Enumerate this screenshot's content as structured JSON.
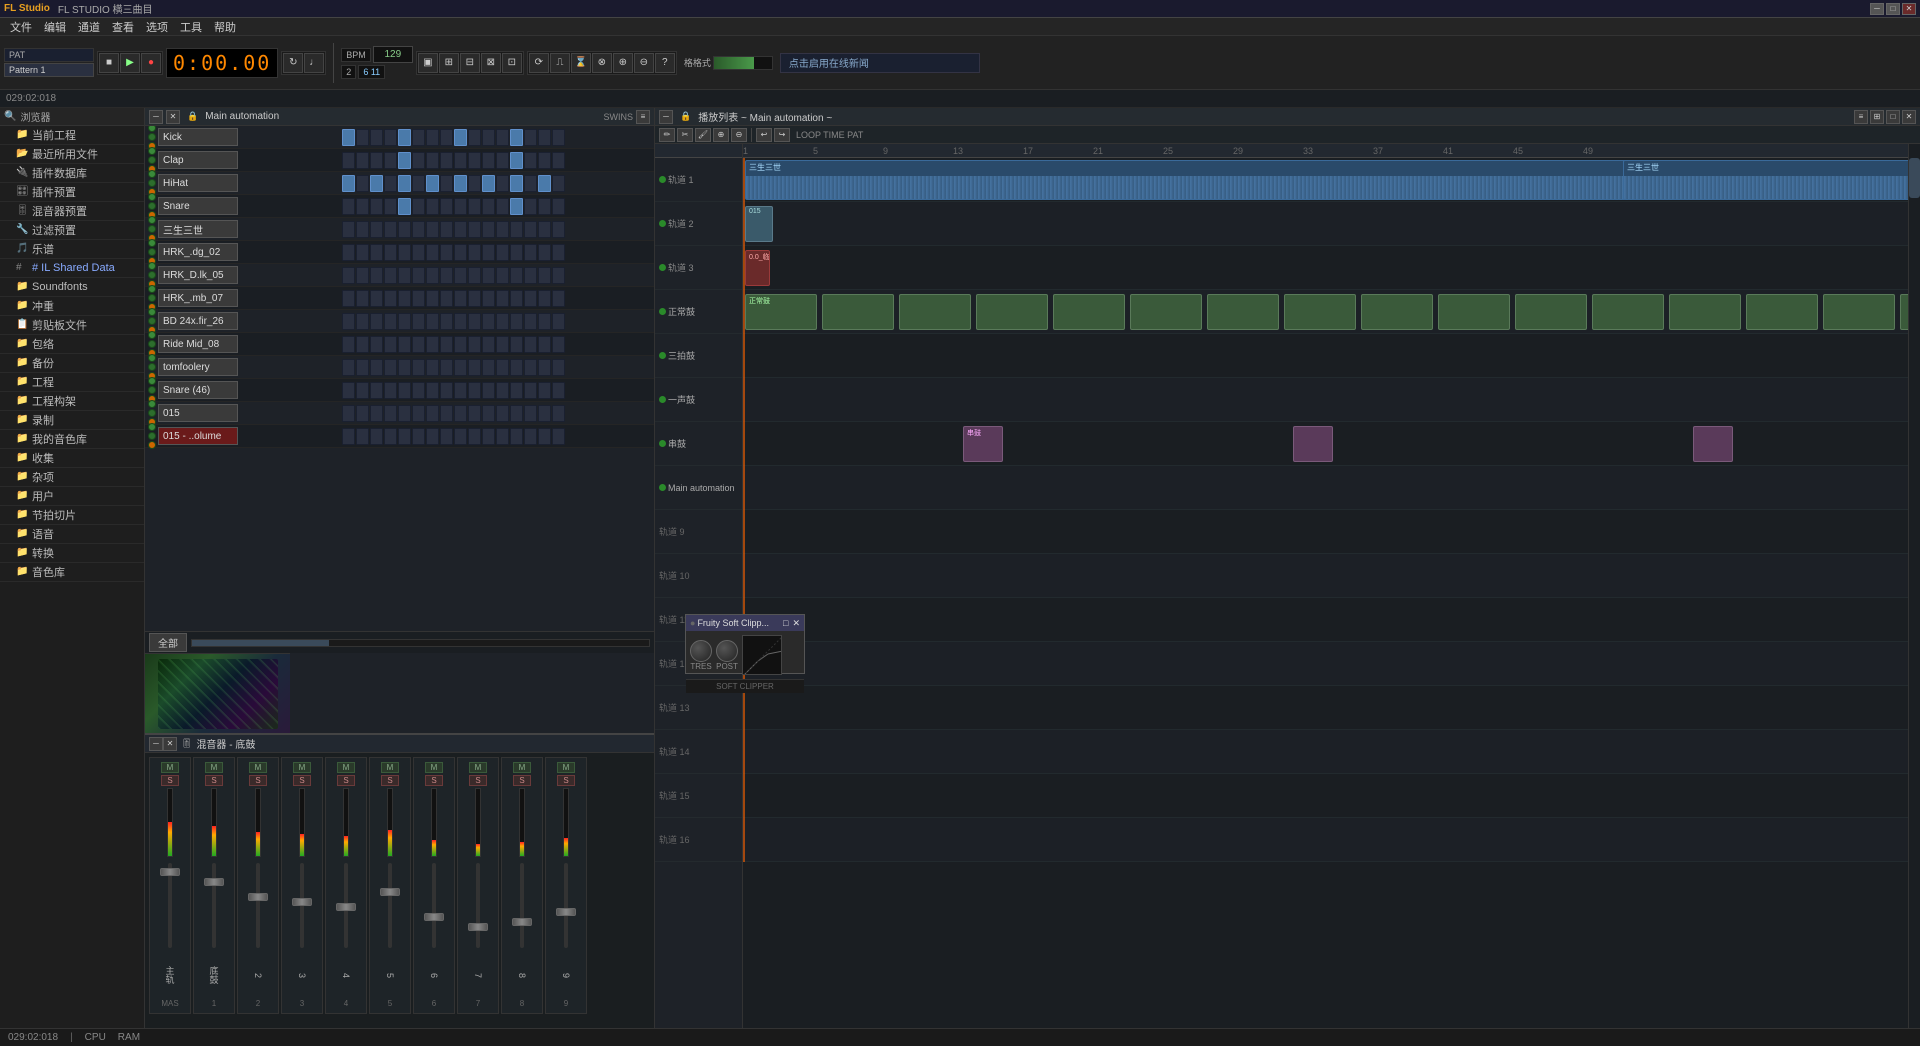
{
  "app": {
    "title": "FL STUDIO 横三曲目",
    "version": "FL Studio"
  },
  "titlebar": {
    "logo": "FL STUDIO",
    "title": "横三曲目",
    "min": "─",
    "max": "□",
    "close": "✕"
  },
  "menubar": {
    "items": [
      "文件",
      "编辑",
      "通道",
      "查看",
      "选项",
      "工具",
      "帮助"
    ]
  },
  "transport": {
    "time": "0:00.00",
    "bpm_label": "BPM",
    "bpm_value": "129",
    "beats_label": "2",
    "info": "029:02:018",
    "play": "▶",
    "stop": "■",
    "record": "●",
    "loop": "↻",
    "pattern": "PAT"
  },
  "toolbar_right": {
    "news_text": "点击启用在线新闻"
  },
  "sidebar": {
    "header": "浏览器",
    "items": [
      {
        "label": "当前工程",
        "icon": "folder"
      },
      {
        "label": "最近所用文件",
        "icon": "folder"
      },
      {
        "label": "插件数据库",
        "icon": "plugin"
      },
      {
        "label": "插件预置",
        "icon": "plugin"
      },
      {
        "label": "混音器预置",
        "icon": "mixer"
      },
      {
        "label": "过滤预置",
        "icon": "filter"
      },
      {
        "label": "乐谱",
        "icon": "music"
      },
      {
        "label": "# IL Shared Data",
        "icon": "folder",
        "highlighted": true
      },
      {
        "label": "Soundfonts",
        "icon": "folder"
      },
      {
        "label": "冲重",
        "icon": "folder"
      },
      {
        "label": "剪贴板文件",
        "icon": "folder"
      },
      {
        "label": "包络",
        "icon": "folder"
      },
      {
        "label": "备份",
        "icon": "folder"
      },
      {
        "label": "工程",
        "icon": "folder"
      },
      {
        "label": "工程构架",
        "icon": "folder"
      },
      {
        "label": "录制",
        "icon": "folder"
      },
      {
        "label": "我的音色库",
        "icon": "folder"
      },
      {
        "label": "收集",
        "icon": "folder"
      },
      {
        "label": "杂项",
        "icon": "folder"
      },
      {
        "label": "用户",
        "icon": "folder"
      },
      {
        "label": "节拍切片",
        "icon": "folder"
      },
      {
        "label": "语音",
        "icon": "folder"
      },
      {
        "label": "转换",
        "icon": "folder"
      },
      {
        "label": "音色库",
        "icon": "folder"
      }
    ]
  },
  "step_sequencer": {
    "title": "Main automation",
    "rows": [
      {
        "name": "Kick",
        "color": "normal",
        "active_steps": [
          0,
          4,
          8,
          12
        ]
      },
      {
        "name": "Clap",
        "color": "normal",
        "active_steps": [
          4,
          12
        ]
      },
      {
        "name": "HiHat",
        "color": "normal",
        "active_steps": [
          0,
          2,
          4,
          6,
          8,
          10,
          12,
          14
        ]
      },
      {
        "name": "Snare",
        "color": "normal",
        "active_steps": [
          4,
          12
        ]
      },
      {
        "name": "三生三世",
        "color": "normal",
        "active_steps": []
      },
      {
        "name": "HRK_.dg_02",
        "color": "normal",
        "active_steps": []
      },
      {
        "name": "HRK_D.lk_05",
        "color": "normal",
        "active_steps": []
      },
      {
        "name": "HRK_.mb_07",
        "color": "normal",
        "active_steps": []
      },
      {
        "name": "BD 24x.fir_26",
        "color": "normal",
        "active_steps": []
      },
      {
        "name": "Ride Mid_08",
        "color": "normal",
        "active_steps": []
      },
      {
        "name": "tomfoolery",
        "color": "normal",
        "active_steps": []
      },
      {
        "name": "Snare (46)",
        "color": "normal",
        "active_steps": []
      },
      {
        "name": "015",
        "color": "normal",
        "active_steps": []
      },
      {
        "name": "015 - ..olume",
        "color": "red",
        "active_steps": []
      }
    ],
    "all_btn": "全部"
  },
  "playlist": {
    "title": "播放列表 ~ Main automation ~",
    "tracks": [
      {
        "name": "轨道 1",
        "type": "audio"
      },
      {
        "name": "轨道 2",
        "type": "audio"
      },
      {
        "name": "轨道 3",
        "type": "audio"
      },
      {
        "name": "正常鼓",
        "type": "midi"
      },
      {
        "name": "三拍鼓",
        "type": "midi"
      },
      {
        "name": "一声鼓",
        "type": "midi"
      },
      {
        "name": "串鼓",
        "type": "midi"
      },
      {
        "name": "Main automation",
        "type": "automation"
      },
      {
        "name": "轨道 9",
        "type": "empty"
      },
      {
        "name": "轨道 10",
        "type": "empty"
      },
      {
        "name": "轨道 11",
        "type": "empty"
      },
      {
        "name": "轨道 12",
        "type": "empty"
      },
      {
        "name": "轨道 13",
        "type": "empty"
      },
      {
        "name": "轨道 14",
        "type": "empty"
      },
      {
        "name": "轨道 15",
        "type": "empty"
      },
      {
        "name": "轨道 16",
        "type": "empty"
      }
    ]
  },
  "clips": {
    "track1_clip1": {
      "label": "三生三世",
      "color": "#2a4a6a",
      "x_pct": 2,
      "width_pct": 90
    },
    "track1_clip2": {
      "label": "三生三世",
      "color": "#2a4a6a",
      "x_pct": 68,
      "width_pct": 32
    },
    "track3_clip1": {
      "label": "0.0_临",
      "color": "#6a2a2a",
      "x_pct": 2,
      "width_pct": 5
    },
    "drums_clip": {
      "label": "正常鼓",
      "color": "#3a5a3a"
    }
  },
  "mixer": {
    "title": "混音器 - 底鼓",
    "channels": [
      {
        "label": "主轨",
        "level": 85
      },
      {
        "label": "底鼓",
        "level": 75
      },
      {
        "label": "2",
        "level": 60
      },
      {
        "label": "3",
        "level": 55
      },
      {
        "label": "4",
        "level": 50
      },
      {
        "label": "5",
        "level": 65
      },
      {
        "label": "6",
        "level": 40
      },
      {
        "label": "7",
        "level": 30
      },
      {
        "label": "8",
        "level": 35
      },
      {
        "label": "9",
        "level": 45
      }
    ]
  },
  "plugin_popup": {
    "title": "Fruity Soft Clipp...",
    "knob1_label": "TRES",
    "knob2_label": "POST",
    "btn_label": "SOFT CLIPPER"
  },
  "statusbar": {
    "info": "029:02:018",
    "cpu": "CPU",
    "ram": "RAM"
  },
  "timeline_markers": [
    "1",
    "5",
    "9",
    "13",
    "17",
    "21",
    "25",
    "29",
    "33",
    "37",
    "41",
    "45",
    "49"
  ]
}
